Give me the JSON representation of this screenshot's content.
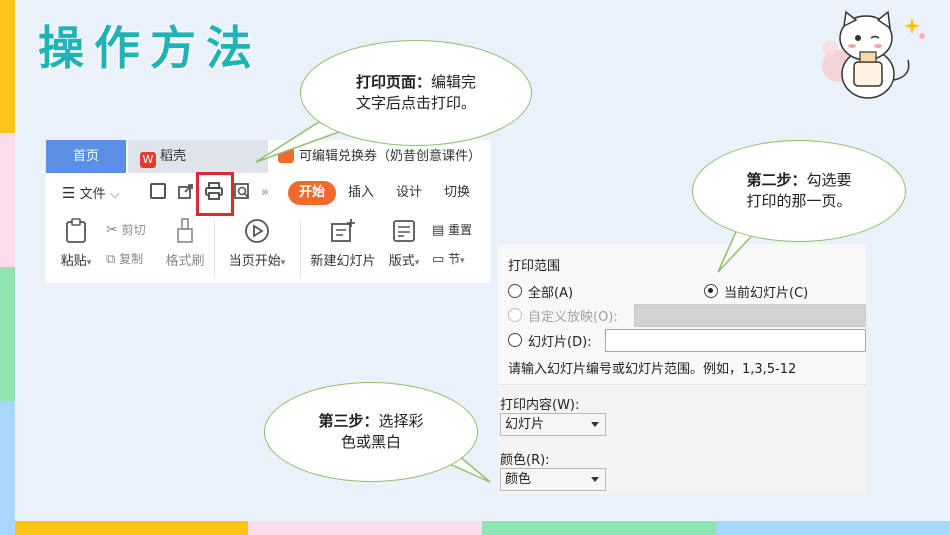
{
  "slide": {
    "title": "操作方法"
  },
  "wps": {
    "tabs": {
      "home": "首页",
      "daoke": "稻壳",
      "daoke_logo": "W",
      "document": "可编辑兑换券（奶昔创意课件）"
    },
    "toolbar": {
      "menu_label": "文件",
      "start": "开始",
      "insert": "插入",
      "design": "设计",
      "switch": "切换",
      "more": "»"
    },
    "ribbon": {
      "paste": "粘贴",
      "cut": "剪切",
      "copy": "复制",
      "format_painter": "格式刷",
      "from_current": "当页开始",
      "new_slide": "新建幻灯片",
      "layout": "版式",
      "reset": "重置",
      "section": "节"
    }
  },
  "print_dialog": {
    "group_title": "打印范围",
    "all": "全部(A)",
    "current": "当前幻灯片(C)",
    "custom": "自定义放映(O):",
    "slides": "幻灯片(D):",
    "hint": "请输入幻灯片编号或幻灯片范围。例如，1,3,5-12",
    "content_label": "打印内容(W):",
    "content_value": "幻灯片",
    "color_label": "颜色(R):",
    "color_value": "颜色"
  },
  "bubbles": {
    "step1_bold": "打印页面：",
    "step1_line1": "编辑完",
    "step1_line2": "文字后点击打印。",
    "step2_bold": "第二步：",
    "step2_line1": "勾选要",
    "step2_line2": "打印的那一页。",
    "step3_bold": "第三步：",
    "step3_line1": "选择彩",
    "step3_line2": "色或黑白"
  },
  "colors": {
    "title": "#1fb3b8",
    "home_tab": "#5b8fe6",
    "start_button": "#f06a2f",
    "highlight_box": "#e0282e",
    "bubble_border": "#8fc06a"
  }
}
